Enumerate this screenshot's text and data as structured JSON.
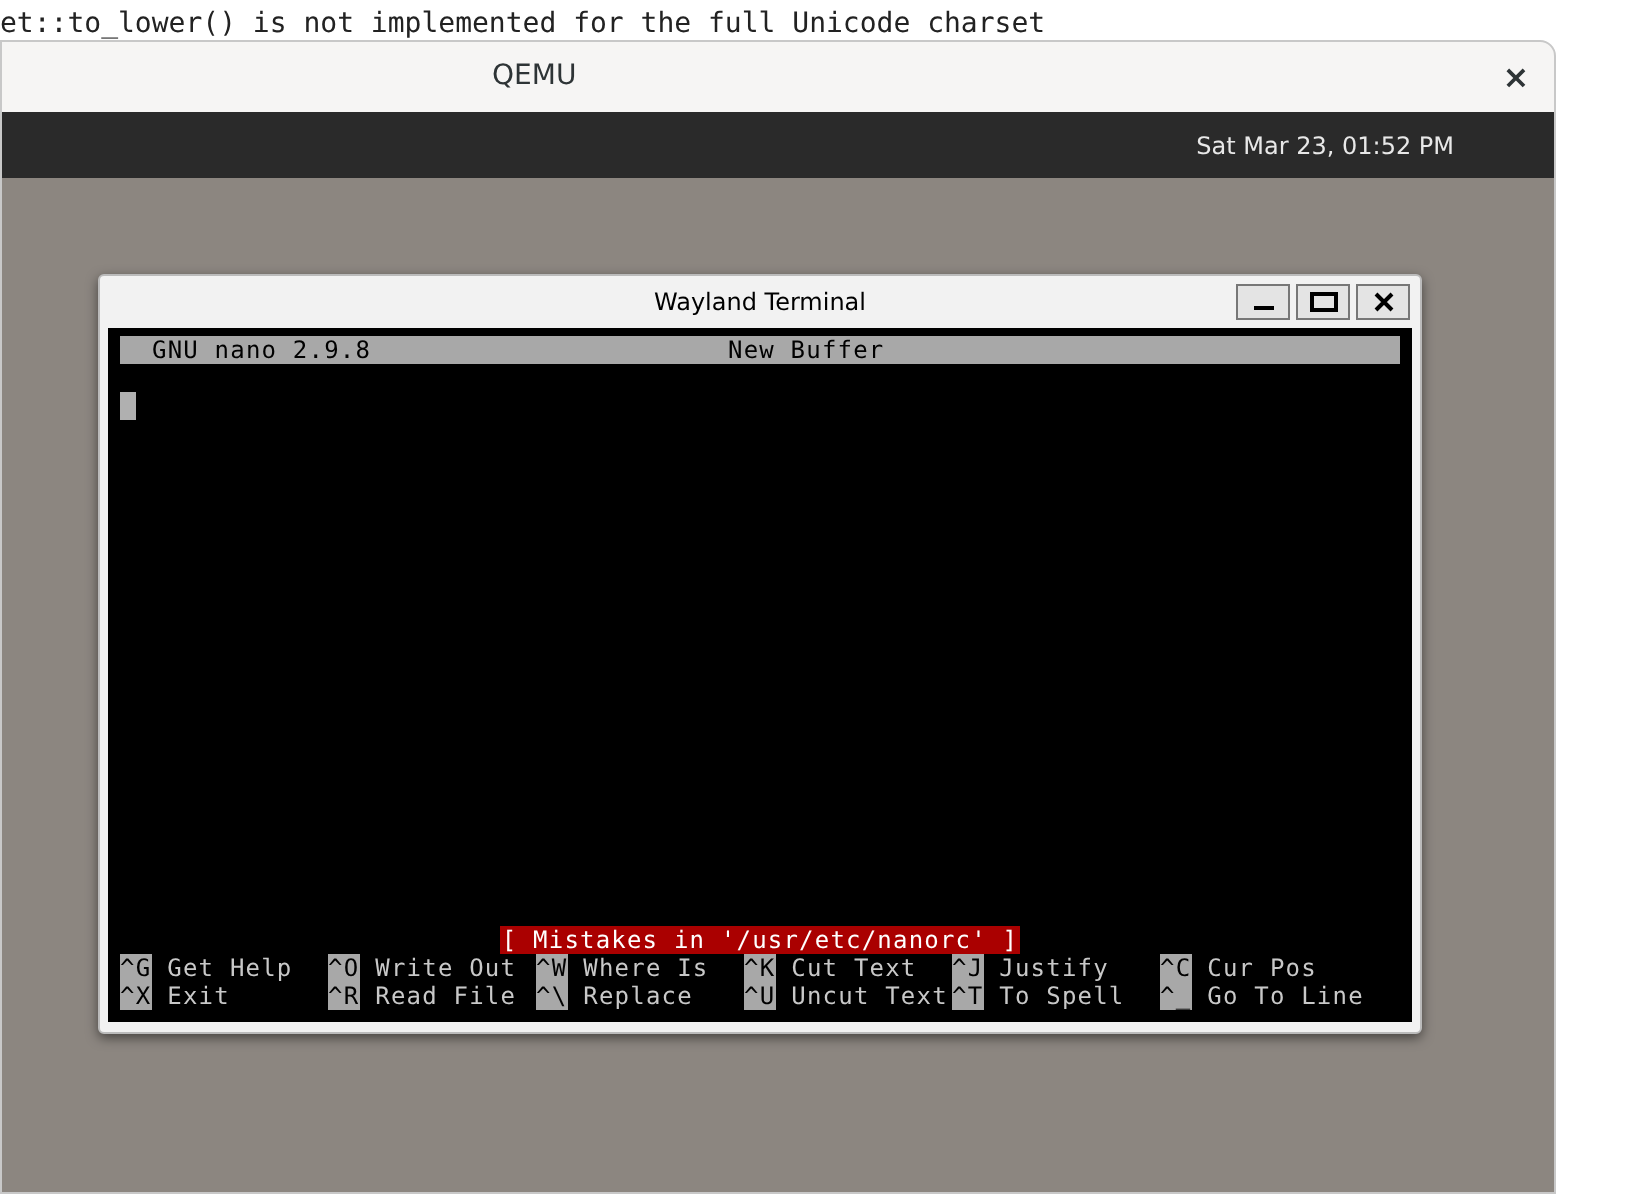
{
  "console_lines": [
    "et::to_lower() is not implemented for the full Unicode charset"
  ],
  "window": {
    "title": "QEMU",
    "close": "×"
  },
  "top_bar": {
    "clock": "Sat Mar 23, 01:52 PM"
  },
  "terminal": {
    "title": "Wayland Terminal",
    "nano": {
      "version": "GNU nano 2.9.8",
      "buffer": "New Buffer",
      "message": "[ Mistakes in '/usr/etc/nanorc' ]",
      "shortcuts": [
        [
          {
            "key": "^G",
            "label": "Get Help"
          },
          {
            "key": "^O",
            "label": "Write Out"
          },
          {
            "key": "^W",
            "label": "Where Is"
          },
          {
            "key": "^K",
            "label": "Cut Text"
          },
          {
            "key": "^J",
            "label": "Justify"
          },
          {
            "key": "^C",
            "label": "Cur Pos"
          }
        ],
        [
          {
            "key": "^X",
            "label": "Exit"
          },
          {
            "key": "^R",
            "label": "Read File"
          },
          {
            "key": "^\\",
            "label": "Replace"
          },
          {
            "key": "^U",
            "label": "Uncut Text"
          },
          {
            "key": "^T",
            "label": "To Spell"
          },
          {
            "key": "^_",
            "label": "Go To Line"
          }
        ]
      ]
    }
  }
}
